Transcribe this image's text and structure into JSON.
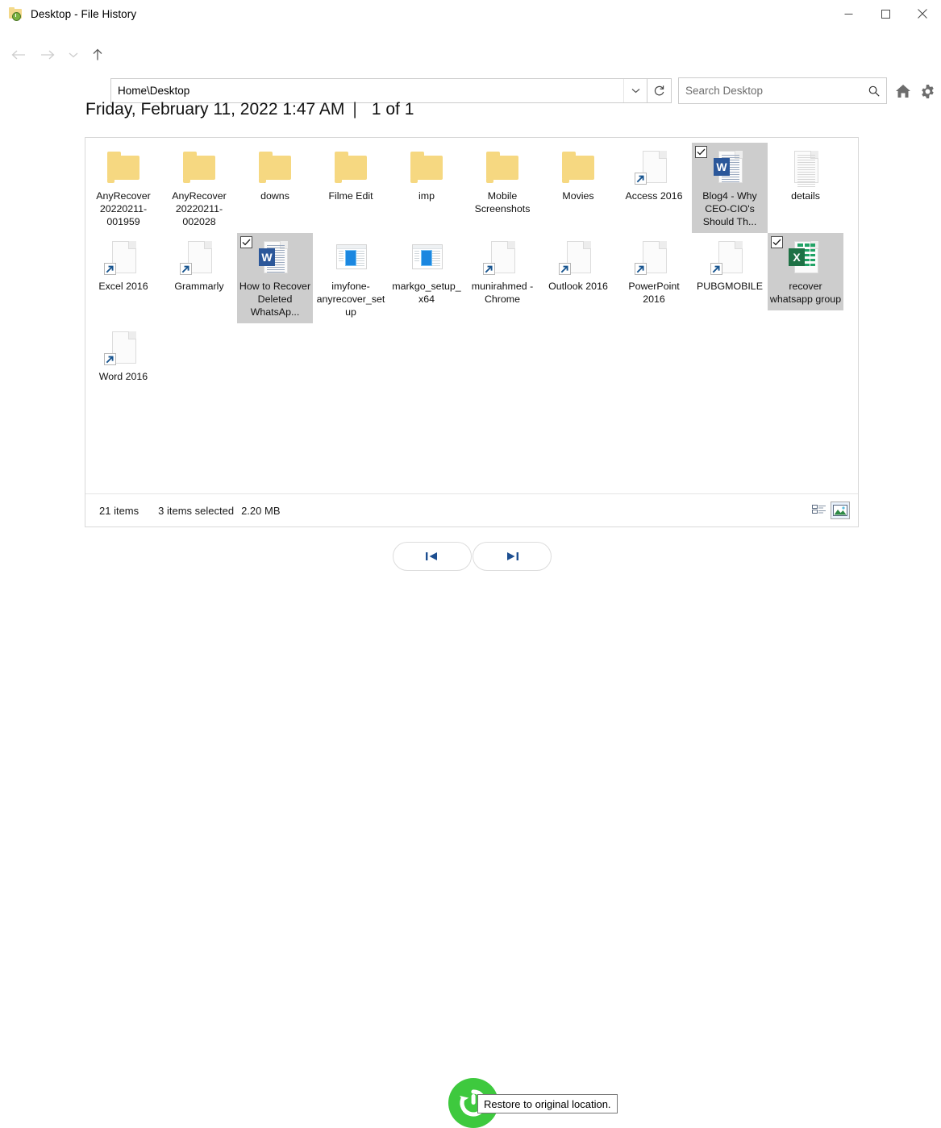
{
  "window": {
    "title": "Desktop - File History",
    "icon": "folder-history-icon",
    "minimize_label": "Minimize",
    "maximize_label": "Maximize",
    "close_label": "Close"
  },
  "nav": {
    "back_label": "Back",
    "forward_label": "Forward",
    "history_label": "Recent locations",
    "up_label": "Up"
  },
  "address": {
    "value": "Home\\Desktop",
    "dropdown_label": "Previous locations",
    "refresh_label": "Refresh"
  },
  "search": {
    "placeholder": "Search Desktop",
    "icon": "search-icon"
  },
  "toolbar_right": {
    "home_label": "Home",
    "settings_label": "Settings"
  },
  "header": {
    "date": "Friday, February 11, 2022 1:47 AM",
    "separator": "|",
    "count": "1 of 1"
  },
  "items": [
    [
      {
        "name": "AnyRecover 20220211-001959",
        "type": "folder",
        "selected": false
      },
      {
        "name": "AnyRecover 20220211-002028",
        "type": "folder",
        "selected": false
      },
      {
        "name": "downs",
        "type": "folder",
        "selected": false
      },
      {
        "name": "Filme Edit",
        "type": "folder",
        "selected": false
      },
      {
        "name": "imp",
        "type": "folder",
        "selected": false
      },
      {
        "name": "Mobile Screenshots",
        "type": "folder",
        "selected": false
      },
      {
        "name": "Movies",
        "type": "folder",
        "selected": false
      },
      {
        "name": "Access 2016",
        "type": "shortcut",
        "selected": false
      },
      {
        "name": "Blog4 - Why CEO-CIO's Should Th...",
        "type": "word",
        "selected": true
      },
      {
        "name": "details",
        "type": "textfile",
        "selected": false
      }
    ],
    [
      {
        "name": "Excel 2016",
        "type": "shortcut",
        "selected": false
      },
      {
        "name": "Grammarly",
        "type": "shortcut",
        "selected": false
      },
      {
        "name": "How to Recover Deleted WhatsAp...",
        "type": "word",
        "selected": true
      },
      {
        "name": "imyfone-anyrecover_setup",
        "type": "exe",
        "selected": false
      },
      {
        "name": "markgo_setup_x64",
        "type": "exe",
        "selected": false
      },
      {
        "name": "munirahmed - Chrome",
        "type": "shortcut",
        "selected": false
      },
      {
        "name": "Outlook 2016",
        "type": "shortcut",
        "selected": false
      },
      {
        "name": "PowerPoint 2016",
        "type": "shortcut",
        "selected": false
      },
      {
        "name": "PUBGMOBILE",
        "type": "shortcut",
        "selected": false
      },
      {
        "name": "recover whatsapp group",
        "type": "excel",
        "selected": true
      }
    ],
    [
      {
        "name": "Word 2016",
        "type": "shortcut",
        "selected": false
      }
    ]
  ],
  "status": {
    "item_count": "21 items",
    "selection": "3 items selected",
    "size": "2.20 MB",
    "details_view_label": "Details view",
    "thumbnail_view_label": "Large icons view"
  },
  "bottom": {
    "previous_label": "Previous version",
    "next_label": "Next version",
    "restore_label": "Restore",
    "tooltip": "Restore to original location."
  },
  "colors": {
    "accent": "#2b579a",
    "excel_green": "#1e7145",
    "restore_green": "#3ec93e",
    "folder_yellow": "#f6d881",
    "selection_gray": "#cdcdcd"
  }
}
